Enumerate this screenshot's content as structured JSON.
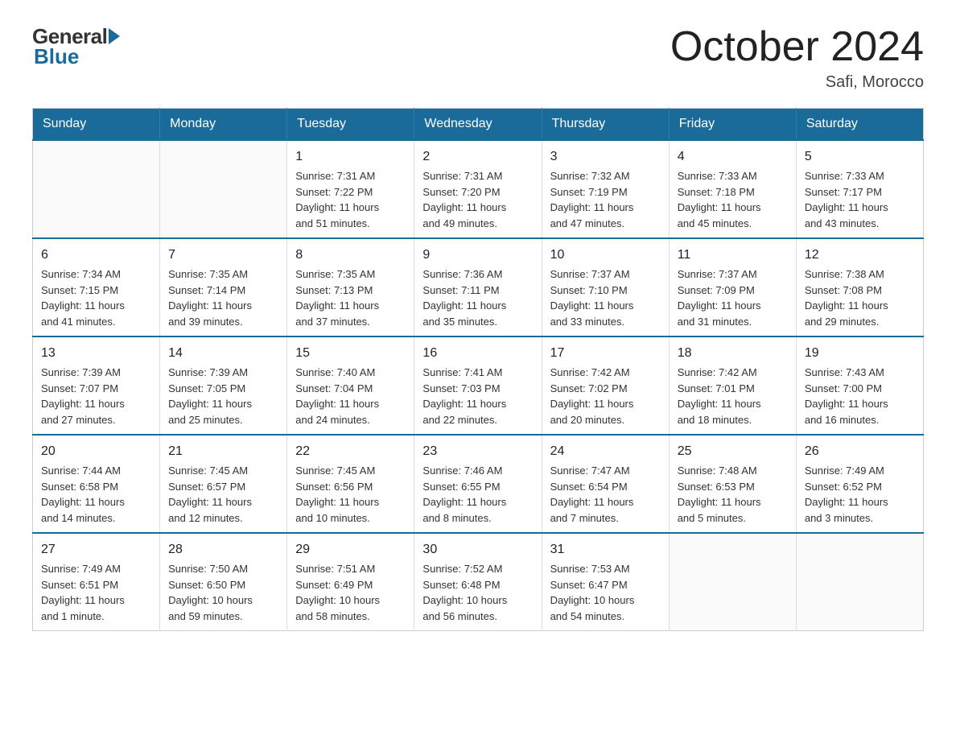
{
  "header": {
    "logo_general": "General",
    "logo_blue": "Blue",
    "month_title": "October 2024",
    "location": "Safi, Morocco"
  },
  "calendar": {
    "days_of_week": [
      "Sunday",
      "Monday",
      "Tuesday",
      "Wednesday",
      "Thursday",
      "Friday",
      "Saturday"
    ],
    "weeks": [
      [
        {
          "day": "",
          "info": ""
        },
        {
          "day": "",
          "info": ""
        },
        {
          "day": "1",
          "info": "Sunrise: 7:31 AM\nSunset: 7:22 PM\nDaylight: 11 hours\nand 51 minutes."
        },
        {
          "day": "2",
          "info": "Sunrise: 7:31 AM\nSunset: 7:20 PM\nDaylight: 11 hours\nand 49 minutes."
        },
        {
          "day": "3",
          "info": "Sunrise: 7:32 AM\nSunset: 7:19 PM\nDaylight: 11 hours\nand 47 minutes."
        },
        {
          "day": "4",
          "info": "Sunrise: 7:33 AM\nSunset: 7:18 PM\nDaylight: 11 hours\nand 45 minutes."
        },
        {
          "day": "5",
          "info": "Sunrise: 7:33 AM\nSunset: 7:17 PM\nDaylight: 11 hours\nand 43 minutes."
        }
      ],
      [
        {
          "day": "6",
          "info": "Sunrise: 7:34 AM\nSunset: 7:15 PM\nDaylight: 11 hours\nand 41 minutes."
        },
        {
          "day": "7",
          "info": "Sunrise: 7:35 AM\nSunset: 7:14 PM\nDaylight: 11 hours\nand 39 minutes."
        },
        {
          "day": "8",
          "info": "Sunrise: 7:35 AM\nSunset: 7:13 PM\nDaylight: 11 hours\nand 37 minutes."
        },
        {
          "day": "9",
          "info": "Sunrise: 7:36 AM\nSunset: 7:11 PM\nDaylight: 11 hours\nand 35 minutes."
        },
        {
          "day": "10",
          "info": "Sunrise: 7:37 AM\nSunset: 7:10 PM\nDaylight: 11 hours\nand 33 minutes."
        },
        {
          "day": "11",
          "info": "Sunrise: 7:37 AM\nSunset: 7:09 PM\nDaylight: 11 hours\nand 31 minutes."
        },
        {
          "day": "12",
          "info": "Sunrise: 7:38 AM\nSunset: 7:08 PM\nDaylight: 11 hours\nand 29 minutes."
        }
      ],
      [
        {
          "day": "13",
          "info": "Sunrise: 7:39 AM\nSunset: 7:07 PM\nDaylight: 11 hours\nand 27 minutes."
        },
        {
          "day": "14",
          "info": "Sunrise: 7:39 AM\nSunset: 7:05 PM\nDaylight: 11 hours\nand 25 minutes."
        },
        {
          "day": "15",
          "info": "Sunrise: 7:40 AM\nSunset: 7:04 PM\nDaylight: 11 hours\nand 24 minutes."
        },
        {
          "day": "16",
          "info": "Sunrise: 7:41 AM\nSunset: 7:03 PM\nDaylight: 11 hours\nand 22 minutes."
        },
        {
          "day": "17",
          "info": "Sunrise: 7:42 AM\nSunset: 7:02 PM\nDaylight: 11 hours\nand 20 minutes."
        },
        {
          "day": "18",
          "info": "Sunrise: 7:42 AM\nSunset: 7:01 PM\nDaylight: 11 hours\nand 18 minutes."
        },
        {
          "day": "19",
          "info": "Sunrise: 7:43 AM\nSunset: 7:00 PM\nDaylight: 11 hours\nand 16 minutes."
        }
      ],
      [
        {
          "day": "20",
          "info": "Sunrise: 7:44 AM\nSunset: 6:58 PM\nDaylight: 11 hours\nand 14 minutes."
        },
        {
          "day": "21",
          "info": "Sunrise: 7:45 AM\nSunset: 6:57 PM\nDaylight: 11 hours\nand 12 minutes."
        },
        {
          "day": "22",
          "info": "Sunrise: 7:45 AM\nSunset: 6:56 PM\nDaylight: 11 hours\nand 10 minutes."
        },
        {
          "day": "23",
          "info": "Sunrise: 7:46 AM\nSunset: 6:55 PM\nDaylight: 11 hours\nand 8 minutes."
        },
        {
          "day": "24",
          "info": "Sunrise: 7:47 AM\nSunset: 6:54 PM\nDaylight: 11 hours\nand 7 minutes."
        },
        {
          "day": "25",
          "info": "Sunrise: 7:48 AM\nSunset: 6:53 PM\nDaylight: 11 hours\nand 5 minutes."
        },
        {
          "day": "26",
          "info": "Sunrise: 7:49 AM\nSunset: 6:52 PM\nDaylight: 11 hours\nand 3 minutes."
        }
      ],
      [
        {
          "day": "27",
          "info": "Sunrise: 7:49 AM\nSunset: 6:51 PM\nDaylight: 11 hours\nand 1 minute."
        },
        {
          "day": "28",
          "info": "Sunrise: 7:50 AM\nSunset: 6:50 PM\nDaylight: 10 hours\nand 59 minutes."
        },
        {
          "day": "29",
          "info": "Sunrise: 7:51 AM\nSunset: 6:49 PM\nDaylight: 10 hours\nand 58 minutes."
        },
        {
          "day": "30",
          "info": "Sunrise: 7:52 AM\nSunset: 6:48 PM\nDaylight: 10 hours\nand 56 minutes."
        },
        {
          "day": "31",
          "info": "Sunrise: 7:53 AM\nSunset: 6:47 PM\nDaylight: 10 hours\nand 54 minutes."
        },
        {
          "day": "",
          "info": ""
        },
        {
          "day": "",
          "info": ""
        }
      ]
    ]
  }
}
